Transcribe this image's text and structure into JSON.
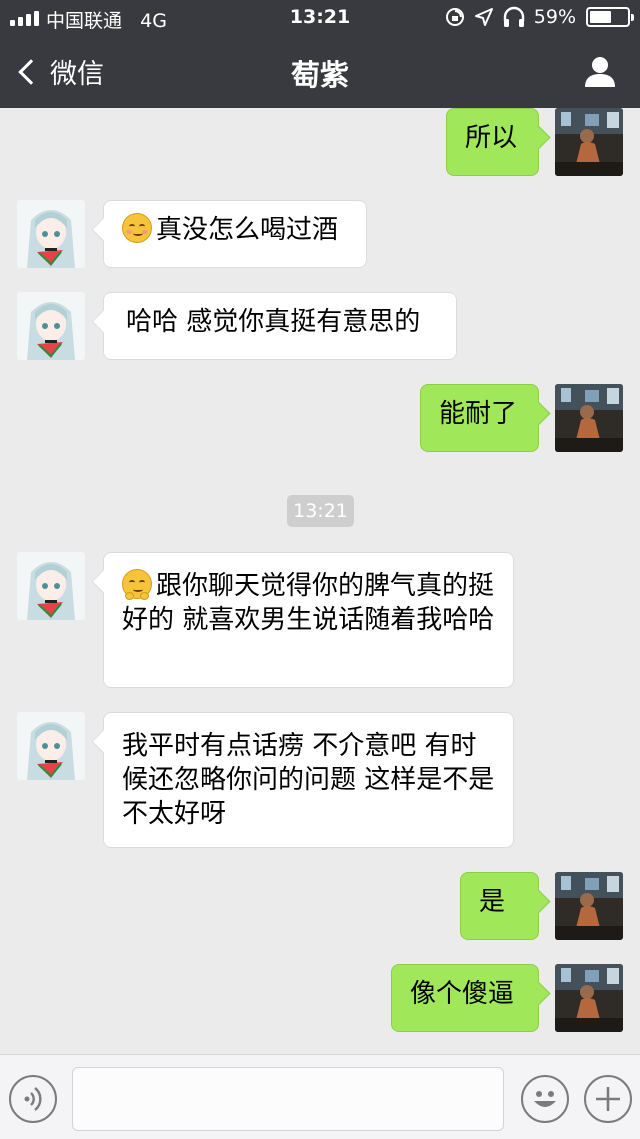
{
  "status_bar": {
    "carrier": "中国联通",
    "network": "4G",
    "time": "13:21",
    "battery_percent_label": "59%",
    "battery_level": 0.59
  },
  "nav": {
    "back_label": "微信",
    "title": "萄紫"
  },
  "messages": [
    {
      "side": "out",
      "text": "所以"
    },
    {
      "side": "in",
      "emoji": "blush-emoji",
      "text": "真没怎么喝过酒"
    },
    {
      "side": "in",
      "text": "哈哈 感觉你真挺有意思的"
    },
    {
      "side": "out",
      "text": "能耐了"
    },
    {
      "side": "in",
      "emoji": "hug-emoji",
      "text": "跟你聊天觉得你的脾气真的挺好的 就喜欢男生说话随着我哈哈"
    },
    {
      "side": "in",
      "text": "我平时有点话痨 不介意吧 有时候还忽略你问的问题 这样是不是不太好呀"
    },
    {
      "side": "out",
      "text": "是"
    },
    {
      "side": "out",
      "text": "像个傻逼"
    }
  ],
  "timestamp": "13:21",
  "input": {
    "value": "",
    "placeholder": ""
  },
  "colors": {
    "nav_bg": "#393a3f",
    "chat_bg": "#ebebeb",
    "outgoing_bubble": "#a0e759",
    "incoming_bubble": "#ffffff"
  },
  "icons": [
    "signal-bars-icon",
    "location-lock-icon",
    "location-arrow-icon",
    "headphones-icon",
    "battery-icon",
    "back-chevron-icon",
    "profile-icon",
    "voice-icon",
    "emoji-face-icon",
    "plus-icon"
  ]
}
